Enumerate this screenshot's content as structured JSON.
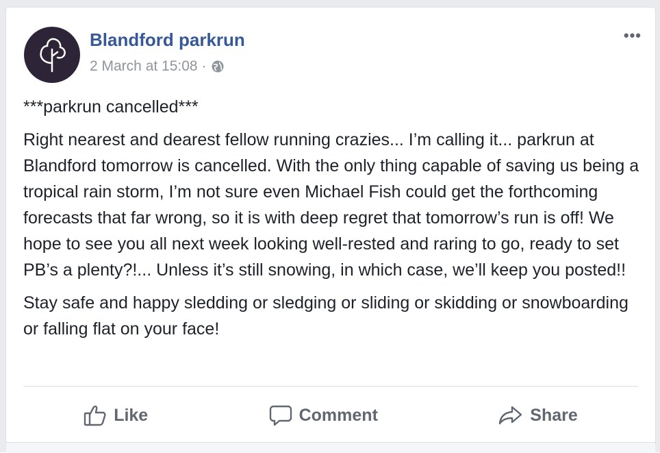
{
  "post": {
    "page_name": "Blandford parkrun",
    "timestamp": "2 March at 15:08",
    "separator": "·",
    "audience_icon": "globe-icon",
    "more_label": "•••",
    "paragraphs": [
      "***parkrun cancelled***",
      "Right nearest and dearest fellow running crazies... I’m calling it... parkrun at Blandford tomorrow is cancelled. With the only thing capable of saving us being a tropical rain storm, I’m not sure even Michael Fish could get the forthcoming forecasts that far wrong, so it is with deep regret that tomorrow’s run is off! We hope to see you all next week looking well-rested and raring to go, ready to set PB’s a plenty?!... Unless it’s still snowing, in which case, we’ll keep you posted!!",
      "Stay safe and happy sledding or sledging or sliding or skidding or snowboarding or falling flat on your face!"
    ]
  },
  "actions": {
    "like_label": "Like",
    "comment_label": "Comment",
    "share_label": "Share"
  },
  "colors": {
    "page_name": "#365899",
    "meta": "#90949c",
    "body_text": "#1d2129",
    "action_text": "#606770",
    "avatar_bg": "#2e2437"
  }
}
